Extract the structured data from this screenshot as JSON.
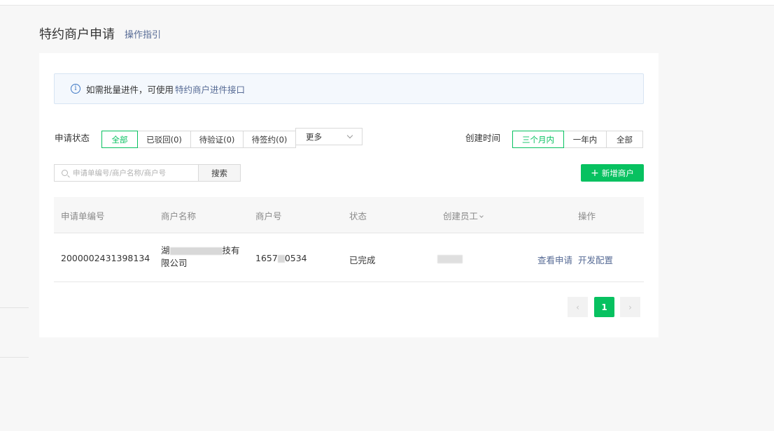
{
  "header": {
    "title": "特约商户申请",
    "guide_link": "操作指引"
  },
  "notice": {
    "text": "如需批量进件，可使用",
    "link": "特约商户进件接口",
    "icon": "info-icon"
  },
  "status_filter": {
    "label": "申请状态",
    "options": [
      "全部",
      "已驳回(0)",
      "待验证(0)",
      "待签约(0)"
    ],
    "active_index": 0,
    "more_label": "更多"
  },
  "time_filter": {
    "label": "创建时间",
    "options": [
      "三个月内",
      "一年内",
      "全部"
    ],
    "active_index": 0
  },
  "search": {
    "placeholder": "申请单编号/商户名称/商户号",
    "button_label": "搜索"
  },
  "add_button": {
    "label": "新增商户"
  },
  "table": {
    "columns": [
      "申请单编号",
      "商户名称",
      "商户号",
      "状态",
      "创建员工",
      "操作"
    ],
    "rows": [
      {
        "application_no": "2000002431398134",
        "merchant_name_start": "湖",
        "merchant_name_mid": "技有",
        "merchant_name_end": "限公司",
        "merchant_no_start": "1657",
        "merchant_no_end": "0534",
        "status": "已完成",
        "actions": [
          "查看申请",
          "开发配置"
        ]
      }
    ]
  },
  "pagination": {
    "current_page": "1",
    "prev_icon": "chevron-left-icon",
    "next_icon": "chevron-right-icon"
  },
  "colors": {
    "brand_green": "#07c160",
    "link_blue": "#576b95",
    "notice_bg": "#f4f8fd"
  }
}
